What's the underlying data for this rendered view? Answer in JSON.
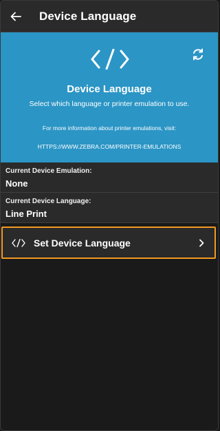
{
  "appbar": {
    "title": "Device Language",
    "back_icon": "arrow-left-icon"
  },
  "hero": {
    "title": "Device Language",
    "subtitle": "Select which language or printer emulation to use.",
    "info": "For more information about printer emulations, visit:",
    "link": "HTTPS://WWW.ZEBRA.COM/PRINTER-EMULATIONS",
    "background": "#2b95c5"
  },
  "emulation": {
    "label": "Current Device Emulation:",
    "value": "None"
  },
  "language": {
    "label": "Current Device Language:",
    "value": "Line Print"
  },
  "set_button": {
    "label": "Set Device Language",
    "accent": "#f39a21"
  }
}
